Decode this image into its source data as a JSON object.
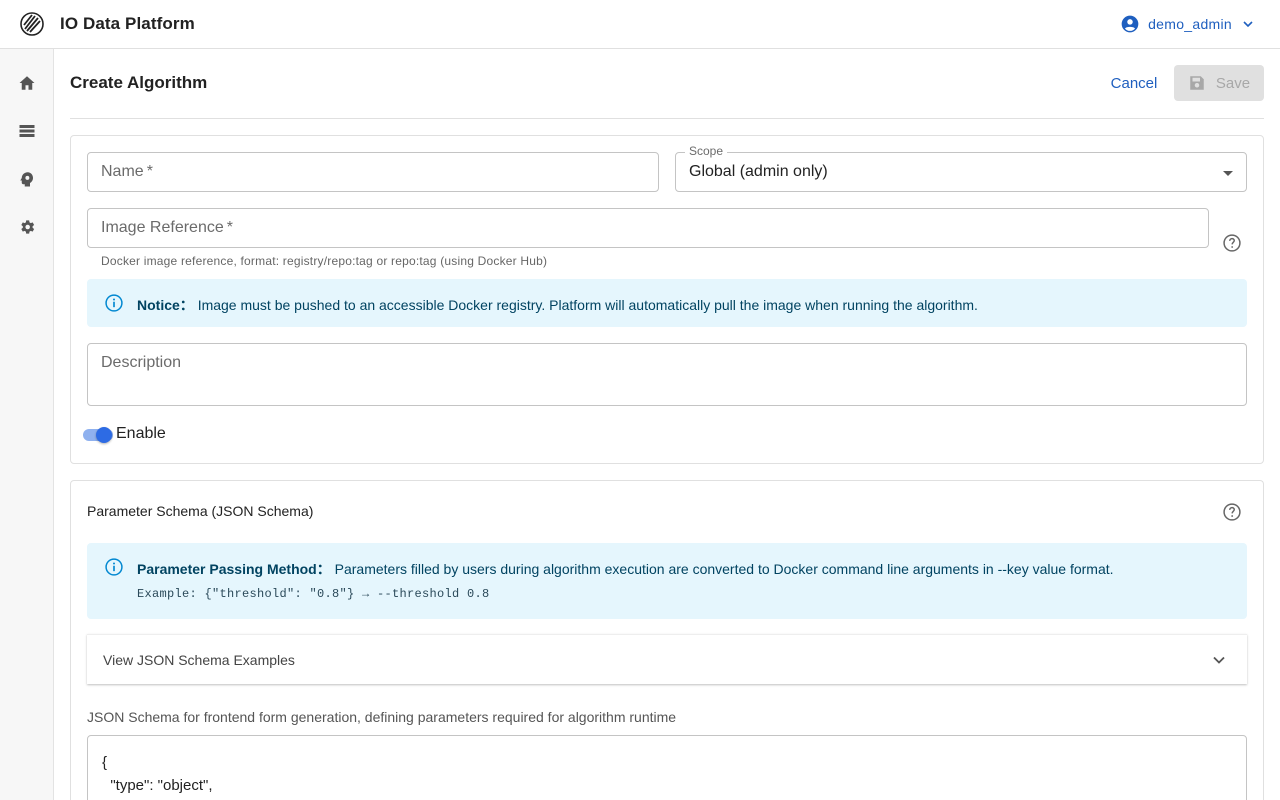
{
  "app": {
    "title": "IO Data Platform",
    "user": "demo_admin"
  },
  "sidebar": {
    "items": [
      {
        "icon": "home-icon"
      },
      {
        "icon": "storage-list-icon"
      },
      {
        "icon": "algorithm-head-icon"
      },
      {
        "icon": "gear-icon"
      }
    ]
  },
  "page": {
    "title": "Create Algorithm",
    "cancel_label": "Cancel",
    "save_label": "Save"
  },
  "form": {
    "name_label": "Name",
    "required_mark": "*",
    "scope_label": "Scope",
    "scope_value": "Global (admin only)",
    "image_label": "Image Reference",
    "image_helper": "Docker image reference, format: registry/repo:tag or repo:tag (using Docker Hub)",
    "notice_title": "Notice：",
    "notice_text": "Image must be pushed to an accessible Docker registry. Platform will automatically pull the image when running the algorithm.",
    "description_label": "Description",
    "enable_label": "Enable",
    "enabled": true
  },
  "schema": {
    "title": "Parameter Schema (JSON Schema)",
    "info_title": "Parameter Passing Method：",
    "info_text": "Parameters filled by users during algorithm execution are converted to Docker command line arguments in --key value format.",
    "example": "Example: {\"threshold\": \"0.8\"} → --threshold 0.8",
    "examples_accordion": "View JSON Schema Examples",
    "helper": "JSON Schema for frontend form generation, defining parameters required for algorithm runtime",
    "code_lines": [
      "{",
      "  \"type\": \"object\","
    ]
  },
  "colors": {
    "primary": "#1f5fbf",
    "info_bg": "#e5f6fd",
    "info_icon": "#0288d1",
    "switch_on": "#2d6be4"
  }
}
